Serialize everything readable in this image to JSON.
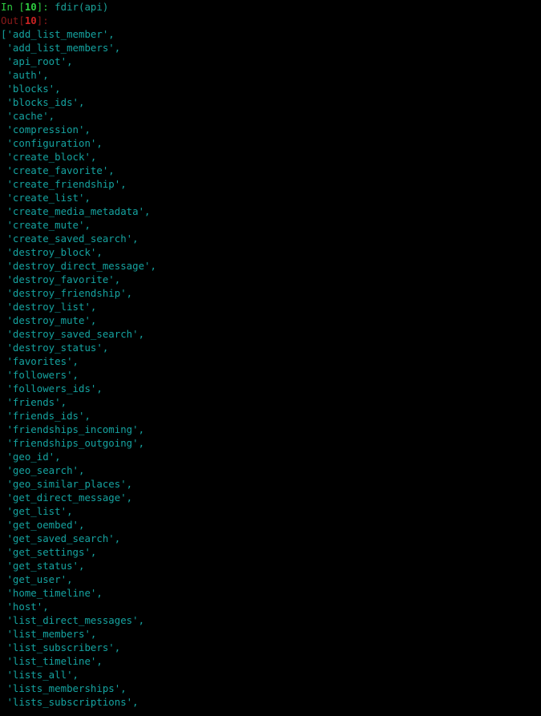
{
  "terminal": {
    "kind": "ipython-console",
    "background_color": "#000000",
    "font_size_px": 12.4,
    "line_height_px": 17,
    "colors": {
      "in_prompt": "#2ecc40",
      "in_prompt_number": "#2ecc40",
      "out_prompt": "#8b1a1a",
      "out_prompt_number": "#cc2222",
      "code": "#1aa39a",
      "string": "#15a3a0"
    },
    "input_cell": {
      "prompt_prefix": "In [",
      "prompt_number": "10",
      "prompt_suffix": "]:",
      "command": "fdir(api)"
    },
    "output_cell": {
      "prompt_prefix": "Out[",
      "prompt_number": "10",
      "prompt_suffix": "]:"
    },
    "output_open_bracket": "[",
    "output_items": [
      "'add_list_member',",
      "'add_list_members',",
      "'api_root',",
      "'auth',",
      "'blocks',",
      "'blocks_ids',",
      "'cache',",
      "'compression',",
      "'configuration',",
      "'create_block',",
      "'create_favorite',",
      "'create_friendship',",
      "'create_list',",
      "'create_media_metadata',",
      "'create_mute',",
      "'create_saved_search',",
      "'destroy_block',",
      "'destroy_direct_message',",
      "'destroy_favorite',",
      "'destroy_friendship',",
      "'destroy_list',",
      "'destroy_mute',",
      "'destroy_saved_search',",
      "'destroy_status',",
      "'favorites',",
      "'followers',",
      "'followers_ids',",
      "'friends',",
      "'friends_ids',",
      "'friendships_incoming',",
      "'friendships_outgoing',",
      "'geo_id',",
      "'geo_search',",
      "'geo_similar_places',",
      "'get_direct_message',",
      "'get_list',",
      "'get_oembed',",
      "'get_saved_search',",
      "'get_settings',",
      "'get_status',",
      "'get_user',",
      "'home_timeline',",
      "'host',",
      "'list_direct_messages',",
      "'list_members',",
      "'list_subscribers',",
      "'list_timeline',",
      "'lists_all',",
      "'lists_memberships',",
      "'lists_subscriptions',"
    ]
  }
}
